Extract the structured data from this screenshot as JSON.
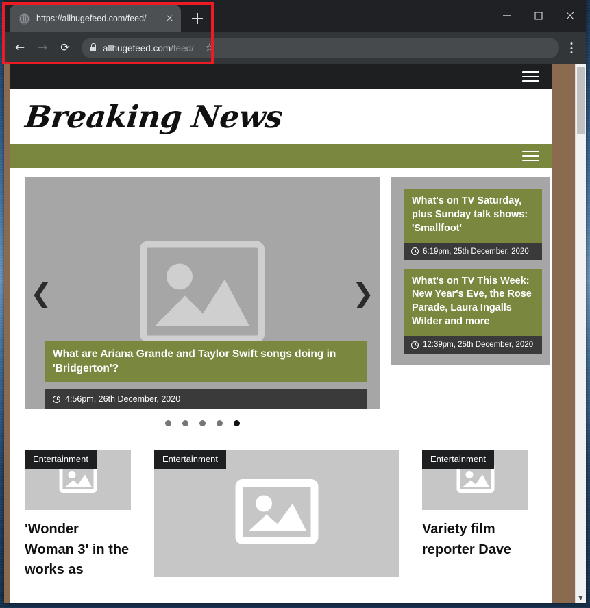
{
  "browser": {
    "tab": {
      "title": "https://allhugefeed.com/feed/",
      "favicon_name": "globe-icon",
      "close_label": "×"
    },
    "new_tab_label": "+",
    "window_controls": {
      "minimize_label": "—",
      "maximize_label": "□",
      "close_label": "×"
    },
    "toolbar": {
      "back_label": "←",
      "forward_label": "→",
      "reload_label": "⟳",
      "lock_name": "lock-icon",
      "url_domain": "allhugefeed.com",
      "url_path": "/feed/",
      "star_label": "☆",
      "menu_label": "⋮"
    },
    "scrollbar": {
      "down_arrow_label": "▼"
    }
  },
  "site": {
    "logo": "Breaking News",
    "topbar_menu_name": "hamburger-menu-icon",
    "navbar_menu_name": "hamburger-menu-icon",
    "colors": {
      "accent_green": "#79873f",
      "dark": "#1d1f21",
      "meta_bar": "#3a3a3a",
      "placeholder_gray": "#a6a6a6",
      "page_bg_brown": "#8b6b4f"
    }
  },
  "carousel": {
    "prev_label": "❮",
    "next_label": "❯",
    "slide": {
      "title": "What are Ariana Grande and Taylor Swift songs doing in 'Bridgerton'?",
      "timestamp": "4:56pm, 26th December, 2020",
      "image_placeholder": "broken-image-icon"
    },
    "dots": [
      {
        "active": false
      },
      {
        "active": false
      },
      {
        "active": false
      },
      {
        "active": false
      },
      {
        "active": true
      }
    ],
    "active_index": 5,
    "total_slides": 5
  },
  "sidebar": {
    "items": [
      {
        "title": "What's on TV Saturday, plus Sunday talk shows: 'Smallfoot'",
        "timestamp": "6:19pm, 25th December, 2020"
      },
      {
        "title": "What's on TV This Week: New Year's Eve, the Rose Parade, Laura Ingalls Wilder and more",
        "timestamp": "12:39pm, 25th December, 2020"
      }
    ]
  },
  "cards": [
    {
      "tag": "Entertainment",
      "title": "'Wonder Woman 3' in the works as",
      "image_placeholder": "broken-image-icon"
    },
    {
      "tag": "Entertainment",
      "title": "",
      "image_placeholder": "broken-image-icon"
    },
    {
      "tag": "Entertainment",
      "title": "Variety film reporter Dave",
      "image_placeholder": "broken-image-icon"
    }
  ],
  "annotation": {
    "color": "#ee1b24",
    "target": "browser-address-and-tab-area"
  }
}
